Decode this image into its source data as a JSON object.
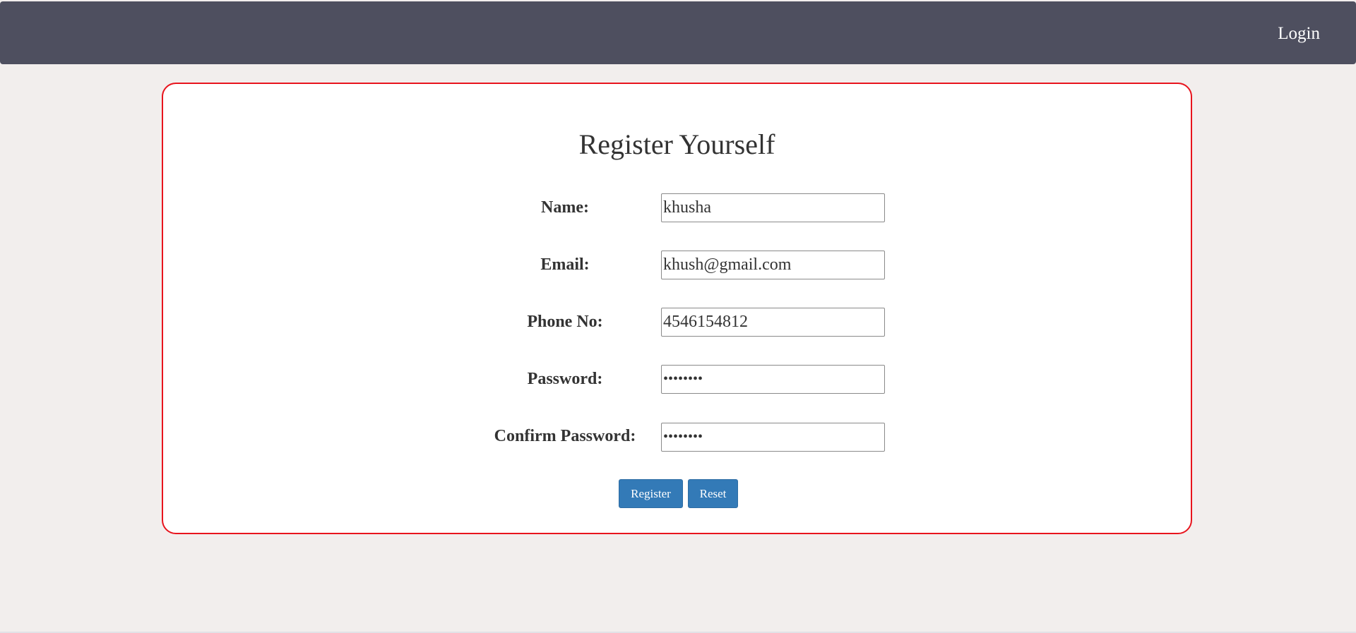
{
  "navbar": {
    "login_label": "Login"
  },
  "form": {
    "title": "Register Yourself",
    "fields": {
      "name": {
        "label": "Name:",
        "value": "khusha"
      },
      "email": {
        "label": "Email:",
        "value": "khush@gmail.com"
      },
      "phone": {
        "label": "Phone No:",
        "value": "4546154812"
      },
      "password": {
        "label": "Password:",
        "value": "••••••••"
      },
      "confirm_password": {
        "label": "Confirm Password:",
        "value": "••••••••"
      }
    },
    "buttons": {
      "register_label": "Register",
      "reset_label": "Reset"
    }
  },
  "colors": {
    "navbar": "#4e4f5f",
    "page_background": "#f2eeed",
    "card_border": "#e8141d",
    "button": "#337ab7"
  }
}
